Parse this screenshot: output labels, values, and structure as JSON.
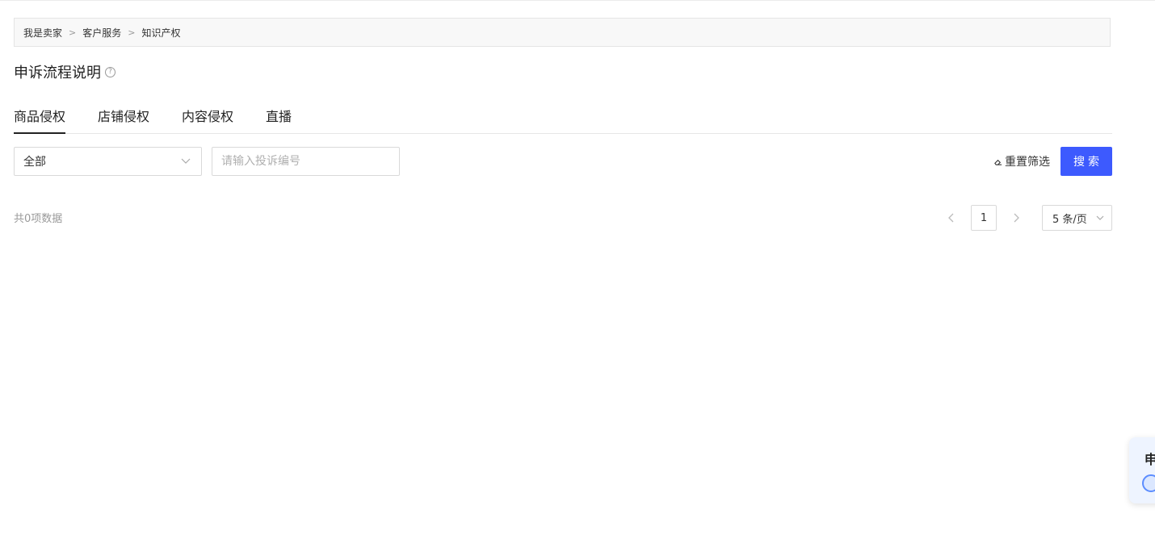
{
  "breadcrumb": {
    "items": [
      "我是卖家",
      "客户服务",
      "知识产权"
    ],
    "separator": ">"
  },
  "page": {
    "title": "申诉流程说明",
    "help_icon": "question-circle-icon"
  },
  "tabs": [
    {
      "label": "商品侵权",
      "active": true
    },
    {
      "label": "店铺侵权",
      "active": false
    },
    {
      "label": "内容侵权",
      "active": false
    },
    {
      "label": "直播",
      "active": false
    }
  ],
  "filters": {
    "status_select": {
      "value": "全部"
    },
    "complaint_input": {
      "value": "",
      "placeholder": "请输入投诉编号"
    },
    "reset_label": "重置筛选",
    "search_label": "搜索"
  },
  "results": {
    "total_text": "共0项数据"
  },
  "pagination": {
    "current_page": "1",
    "page_size": "5 条/页"
  },
  "float_widget": {
    "text": "申"
  },
  "colors": {
    "primary": "#3d5afe",
    "text": "#333333",
    "muted": "#999999",
    "border": "#d9d9d9"
  }
}
